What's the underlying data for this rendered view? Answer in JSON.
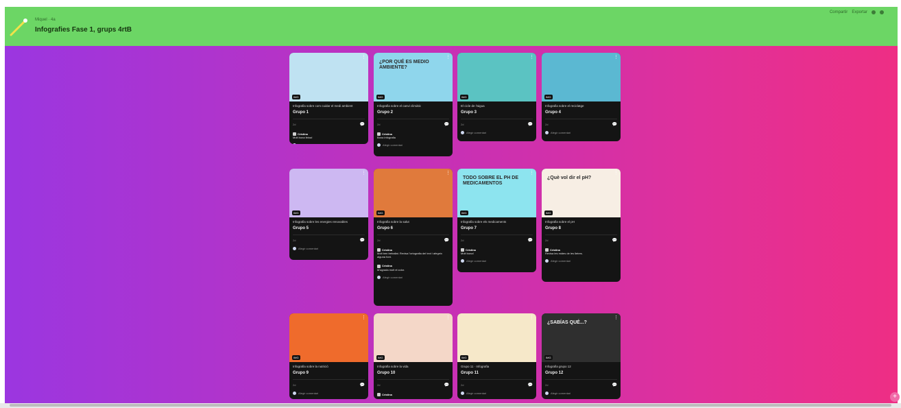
{
  "header": {
    "app_label": "Padlet",
    "meta": "Miquel · 4a",
    "title": "Infografies Fase 1, grups 4rtB",
    "actions": [
      "Compartir",
      "Exportar"
    ]
  },
  "add_comment_label": "Afegir comentari",
  "cards": [
    {
      "title": "Infografia sobre com cuidar el medi ambient",
      "group": "Grupo 1",
      "time": "2d",
      "comment": {
        "author": "Cristina",
        "text": "Molt bona feina!"
      },
      "bg": "#bfe2f2",
      "thumb_text": "",
      "tag": "IMG"
    },
    {
      "title": "Infografia sobre el canvi climàtic",
      "group": "Grupo 2",
      "time": "2d",
      "comment": {
        "author": "Cristina",
        "text": "Bona infografia"
      },
      "bg": "#8fd6ec",
      "thumb_text": "¿POR QUÉ ES MEDIO AMBIENTE?",
      "tag": "IMG"
    },
    {
      "title": "El cicle de l'aigua",
      "group": "Grupo 3",
      "time": "2d",
      "comment": null,
      "bg": "#5bc3c2",
      "thumb_text": "",
      "tag": "IMG"
    },
    {
      "title": "Infografia sobre el reciclatge",
      "group": "Grupo 4",
      "time": "2d",
      "comment": null,
      "bg": "#5bb8d2",
      "thumb_text": "",
      "tag": "IMG"
    },
    {
      "title": "Infografia sobre les energies renovables",
      "group": "Grupo 5",
      "time": "2d",
      "comment": null,
      "bg": "#cdb8f2",
      "thumb_text": "",
      "tag": "IMG"
    },
    {
      "title": "Infografia sobre la salut",
      "group": "Grupo 6",
      "time": "2d",
      "comment": {
        "author": "Cristina",
        "text": "Molt ben treballat. Revisa l'ortografia del text i afegeix alguna font."
      },
      "comment2": {
        "author": "Cristina",
        "text": "M'agrada molt el color."
      },
      "bg": "#e07a3c",
      "thumb_text": "",
      "tag": "IMG"
    },
    {
      "title": "Infografia sobre els medicaments",
      "group": "Grupo 7",
      "time": "2d",
      "comment": {
        "author": "Cristina",
        "text": "Molt bona!"
      },
      "bg": "#8de4ef",
      "thumb_text": "TODO SOBRE EL PH DE MEDICAMENTOS",
      "tag": "IMG"
    },
    {
      "title": "Infografia sobre el pH",
      "group": "Grupo 8",
      "time": "2d",
      "comment": {
        "author": "Cristina",
        "text": "Revisa les mides de les lletres."
      },
      "bg": "#f7eee4",
      "thumb_text": "¿Què vol dir el pH?",
      "tag": "IMG"
    },
    {
      "title": "Infografia sobre la nutrició",
      "group": "Grupo 9",
      "time": "2d",
      "comment": null,
      "bg": "#ef6b2c",
      "thumb_text": "",
      "tag": "IMG"
    },
    {
      "title": "Infografia sobre la vida",
      "group": "Grupo 10",
      "time": "2d",
      "comment": {
        "author": "Cristina",
        "text": ""
      },
      "bg": "#f4d7c8",
      "thumb_text": "",
      "tag": "IMG"
    },
    {
      "title": "Grupo 11 · Infografia",
      "group": "Grupo 11",
      "time": "2d",
      "comment": null,
      "bg": "#f6e8c9",
      "thumb_text": "",
      "tag": "IMG"
    },
    {
      "title": "Infografia grupo 12",
      "group": "Grupo 12",
      "time": "2d",
      "comment": null,
      "bg": "#2f2f2f",
      "thumb_text": "¿SABÍAS QUÉ...?",
      "tag": "IMG"
    }
  ],
  "icons": {
    "logo": "wand-icon",
    "comment": "comment-icon",
    "kebab": "more-icon",
    "add": "plus-icon"
  },
  "colors": {
    "header_bg": "#6cd665",
    "gradient_start": "#9b36e0",
    "gradient_end": "#ee2e84",
    "card_bg": "#141414"
  }
}
